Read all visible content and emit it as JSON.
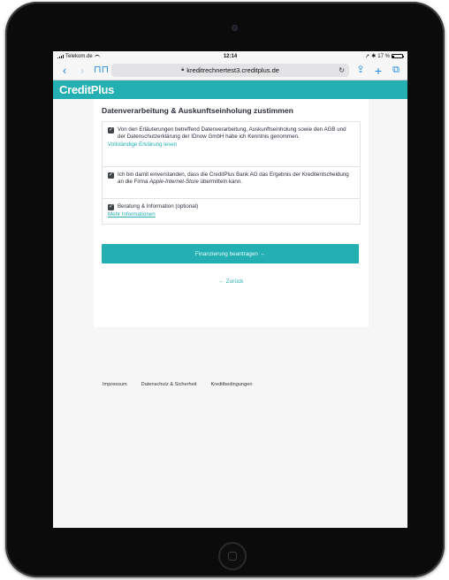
{
  "status": {
    "carrier": "Telekom.de",
    "time": "12:14",
    "battery": "17 %"
  },
  "browser": {
    "url": "kreditrechnertest3.creditplus.de"
  },
  "brand": {
    "name": "CreditPlus",
    "color": "#24b0b3"
  },
  "page": {
    "title": "Datenverarbeitung & Auskunftseinholung zustimmen",
    "consents": [
      {
        "text": "Von den Erläuterungen betreffend Datenverarbeitung, Auskunftseinholung sowie den AGB und der Datenschutzerklärung der IDnow GmbH habe ich Kenntnis genommen.",
        "link": "Vollständige Erklärung lesen"
      },
      {
        "text_before": "Ich bin damit einverstanden, dass die CreditPlus Bank AG das Ergebnis der Kreditentscheidung an die Firma ",
        "text_em": "Apple-Internet-Store",
        "text_after": " übermitteln kann."
      },
      {
        "text": "Beratung & Information (optional)",
        "link": "Mehr Informationen"
      }
    ],
    "primary_button": "Finanzierung beantragen →",
    "back_link": "← Zurück"
  },
  "footer": {
    "links": [
      "Impressum",
      "Datenschutz & Sicherheit",
      "Kreditbedingungen"
    ]
  }
}
